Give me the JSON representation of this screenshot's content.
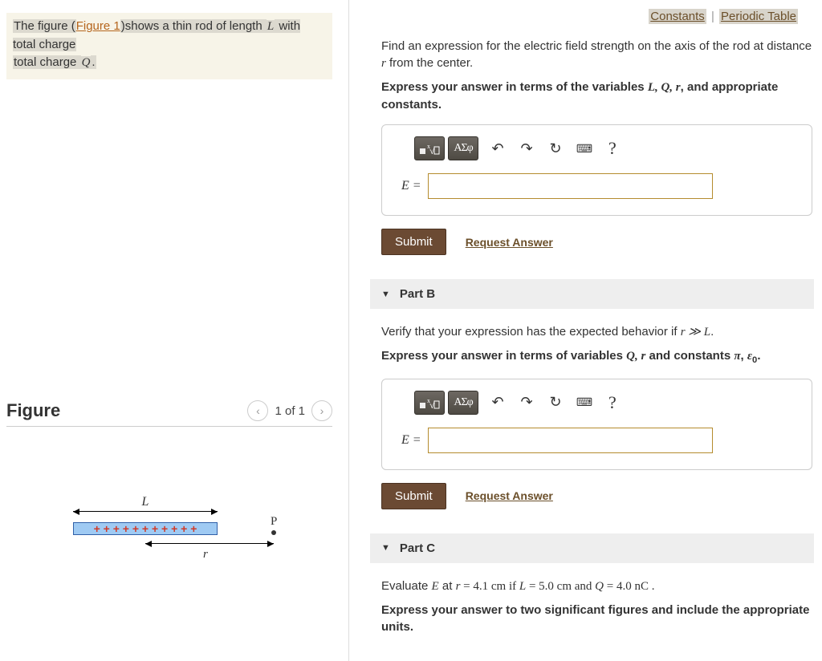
{
  "intro": {
    "pre": "The figure (",
    "figlink": "Figure 1",
    "mid": ")shows a thin rod of length ",
    "varL": "L",
    "mid2": " with total charge ",
    "varQ": "Q",
    "post": "."
  },
  "figurePanel": {
    "title": "Figure",
    "nav": {
      "counter": "1 of 1"
    }
  },
  "figureDiagram": {
    "labelL": "L",
    "labelR": "r",
    "pointP": "P",
    "rodCharges": "+ + + + + + + + + + +"
  },
  "topLinks": {
    "constants": "Constants",
    "periodic": "Periodic Table"
  },
  "partA": {
    "prompt1": "Find an expression for the electric field strength on the axis of the rod at distance ",
    "var_r": "r",
    "prompt2": " from the center.",
    "instr1": "Express your answer in terms of the variables ",
    "instr_vars": "L, Q, r",
    "instr2": ", and appropriate constants.",
    "lhs": "E =",
    "submit": "Submit",
    "request": "Request Answer"
  },
  "partB": {
    "header": "Part B",
    "prompt1": "Verify that your expression has the expected behavior if ",
    "cond": "r ≫ L",
    "prompt2": ".",
    "instr1": "Express your answer in terms of variables ",
    "instr_qr": "Q, r",
    "instr2": " and constants ",
    "instr_pi": "π",
    "instr_comma": ", ",
    "instr_eps": "ε",
    "instr_eps0": "0",
    "instr_end": ".",
    "lhs": "E =",
    "submit": "Submit",
    "request": "Request Answer"
  },
  "partC": {
    "header": "Part C",
    "prompt1": "Evaluate ",
    "varE": "E",
    "prompt2": " at ",
    "var_r": "r",
    "eq1": " = 4.1 cm if ",
    "varL2": "L",
    "eq2": " = 5.0 cm and ",
    "varQ2": "Q",
    "eq3": " = 4.0 nC .",
    "instr": "Express your answer to two significant figures and include the appropriate units."
  },
  "toolbar": {
    "templatesAria": "templates",
    "greekAria": "greek letters",
    "greekLabel": "ΑΣφ",
    "undo": "↶",
    "redo": "↷",
    "reset": "↻",
    "keyboard": "⌨",
    "help": "?"
  }
}
